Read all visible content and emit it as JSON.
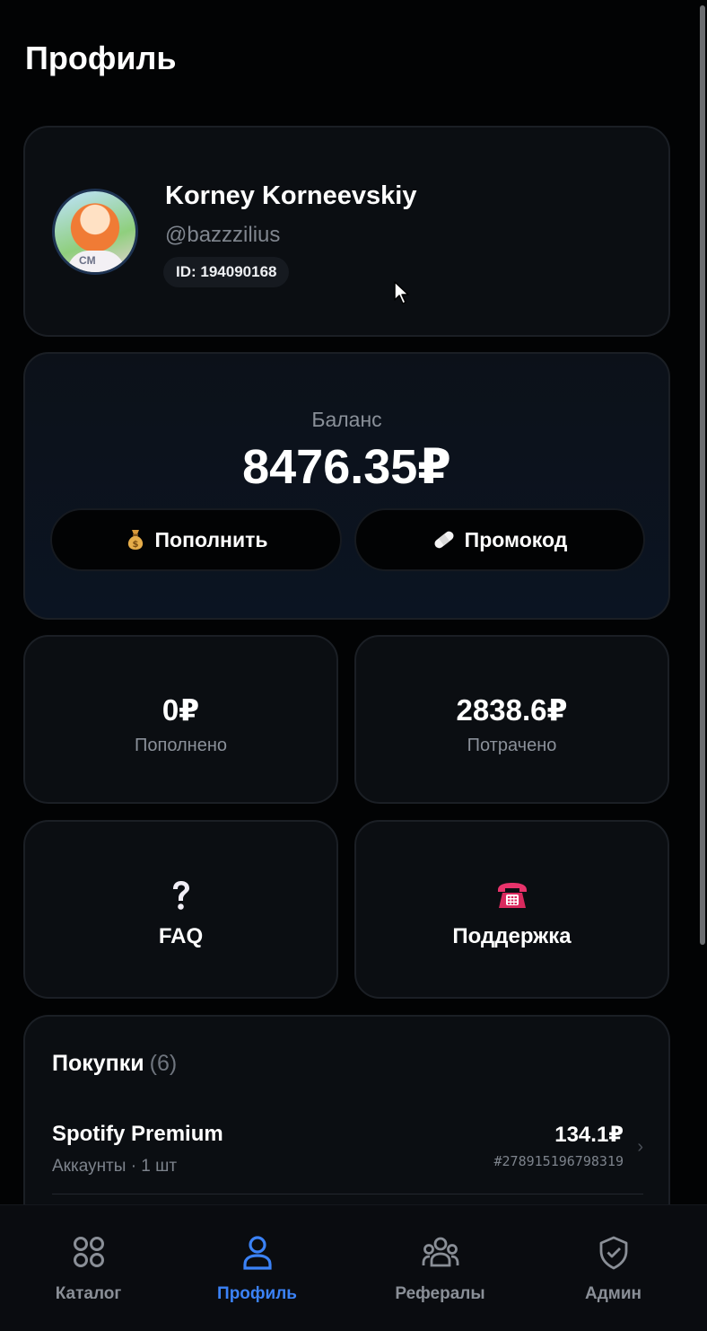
{
  "page": {
    "title": "Профиль"
  },
  "profile": {
    "name": "Korney Korneevskiy",
    "handle": "@bazzzilius",
    "id_label": "ID: 194090168",
    "avatar_letters": "CM"
  },
  "balance": {
    "label": "Баланс",
    "value": "8476.35₽",
    "topup_label": "Пополнить",
    "topup_icon": "money-bag",
    "promo_label": "Промокод",
    "promo_icon": "bandage"
  },
  "stats": {
    "deposited_value": "0₽",
    "deposited_label": "Пополнено",
    "spent_value": "2838.6₽",
    "spent_label": "Потрачено"
  },
  "actions": {
    "faq_label": "FAQ",
    "faq_icon": "question-mark",
    "support_label": "Поддержка",
    "support_icon": "telephone"
  },
  "purchases": {
    "title": "Покупки",
    "count": "(6)",
    "items": [
      {
        "name": "Spotify Premium",
        "meta": "Аккаунты · 1 шт",
        "price": "134.1₽",
        "order": "#278915196798319"
      }
    ]
  },
  "nav": {
    "items": [
      {
        "label": "Каталог",
        "icon": "grid-icon",
        "active": false
      },
      {
        "label": "Профиль",
        "icon": "user-icon",
        "active": true
      },
      {
        "label": "Рефералы",
        "icon": "group-icon",
        "active": false
      },
      {
        "label": "Админ",
        "icon": "shield-check-icon",
        "active": false
      }
    ]
  },
  "colors": {
    "accent": "#3b82f6",
    "background": "#020304",
    "card": "#0b0e12"
  }
}
